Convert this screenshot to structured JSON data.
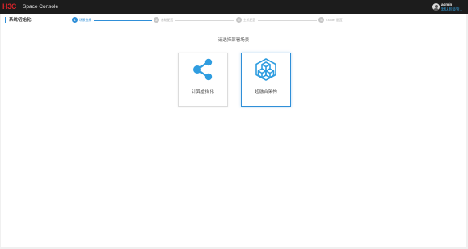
{
  "topbar": {
    "logo": "H3C",
    "product_name": "Space Console",
    "user": {
      "name": "admin",
      "role": "默认超级管..."
    }
  },
  "page": {
    "title": "系统初始化",
    "steps": [
      {
        "number": "1",
        "label": "场景选择",
        "active": true
      },
      {
        "number": "2",
        "label": "基础配置",
        "active": false
      },
      {
        "number": "3",
        "label": "主机配置",
        "active": false
      },
      {
        "number": "4",
        "label": "Cluster 配置",
        "active": false
      }
    ],
    "prompt": "请选择部署场景",
    "options": [
      {
        "label": "计算虚拟化",
        "icon": "share-nodes-icon",
        "selected": false
      },
      {
        "label": "超融合架构",
        "icon": "hexagon-cubes-icon",
        "selected": true
      }
    ]
  },
  "colors": {
    "accent": "#2f8fd8",
    "topbar": "#1c1c1c",
    "brand_red": "#d8242a"
  }
}
